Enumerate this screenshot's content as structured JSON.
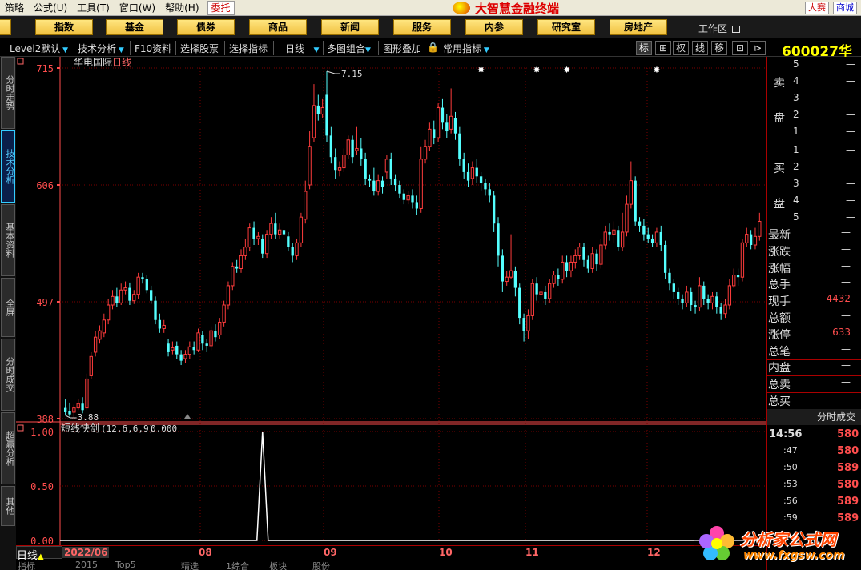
{
  "menubar": {
    "items": [
      "策略",
      "公式(U)",
      "工具(T)",
      "窗口(W)",
      "帮助(H)"
    ],
    "entrust": "委托",
    "brand": "大智慧金融终端",
    "right_buttons": [
      "大赛",
      "商城"
    ]
  },
  "navbar": {
    "buttons": [
      "指数",
      "基金",
      "债券",
      "商品",
      "新闻",
      "服务",
      "内参",
      "研究室",
      "房地产"
    ],
    "workzone": "工作区"
  },
  "toolbar": {
    "level2": "Level2默认",
    "tech": "技术分析",
    "f10": "F10资料",
    "select_stock": "选择股票",
    "select_indicator": "选择指标",
    "period": "日线",
    "multi": "多图组合",
    "overlay": "图形叠加",
    "common": "常用指标",
    "tiny_buttons": [
      "标",
      "⊞",
      "权",
      "线",
      "移",
      "⊡",
      "⊳"
    ],
    "stock_code": "600027",
    "stock_code_suffix": "华"
  },
  "side_tabs": [
    "分时走势",
    "技术分析",
    "基本资料",
    "全屏",
    "分时成交",
    "超赢分析",
    "其他"
  ],
  "chart_data": [
    {
      "type": "candlestick",
      "title": "华电国际日线",
      "title_stock": "华电国际",
      "title_period": "日线",
      "ylim": [
        388,
        715
      ],
      "y_ticks": [
        715,
        606,
        497,
        388
      ],
      "y_tick_labels": [
        "715",
        "606",
        "497",
        "388"
      ],
      "annotations": {
        "high": "7.15",
        "low": "3.88"
      },
      "date_labels": [
        "2022/06",
        "08",
        "09",
        "10",
        "11",
        "12"
      ],
      "candles": [
        [
          398,
          394,
          406,
          391
        ],
        [
          395,
          392,
          403,
          390
        ],
        [
          394,
          398,
          401,
          389
        ],
        [
          398,
          402,
          406,
          396
        ],
        [
          402,
          396,
          408,
          393
        ],
        [
          398,
          425,
          430,
          396
        ],
        [
          428,
          446,
          450,
          425
        ],
        [
          450,
          464,
          470,
          446
        ],
        [
          462,
          470,
          475,
          458
        ],
        [
          468,
          480,
          486,
          464
        ],
        [
          480,
          494,
          500,
          476
        ],
        [
          494,
          502,
          508,
          490
        ],
        [
          502,
          496,
          510,
          492
        ],
        [
          496,
          508,
          514,
          494
        ],
        [
          508,
          510,
          516,
          504
        ],
        [
          510,
          498,
          515,
          494
        ],
        [
          498,
          504,
          508,
          495
        ],
        [
          504,
          520,
          524,
          500
        ],
        [
          520,
          518,
          524,
          514
        ],
        [
          518,
          508,
          522,
          505
        ],
        [
          508,
          498,
          512,
          495
        ],
        [
          498,
          480,
          502,
          476
        ],
        [
          480,
          472,
          486,
          468
        ],
        [
          472,
          475,
          480,
          468
        ],
        [
          458,
          450,
          462,
          446
        ],
        [
          452,
          454,
          460,
          448
        ],
        [
          456,
          448,
          460,
          444
        ],
        [
          448,
          442,
          452,
          438
        ],
        [
          444,
          448,
          452,
          440
        ],
        [
          448,
          455,
          460,
          444
        ],
        [
          455,
          452,
          460,
          448
        ],
        [
          452,
          468,
          472,
          450
        ],
        [
          466,
          458,
          470,
          452
        ],
        [
          458,
          456,
          462,
          450
        ],
        [
          456,
          470,
          474,
          452
        ],
        [
          470,
          464,
          476,
          460
        ],
        [
          466,
          478,
          482,
          462
        ],
        [
          478,
          494,
          498,
          474
        ],
        [
          494,
          512,
          516,
          490
        ],
        [
          512,
          530,
          534,
          508
        ],
        [
          530,
          528,
          536,
          524
        ],
        [
          528,
          540,
          546,
          524
        ],
        [
          540,
          548,
          556,
          536
        ],
        [
          548,
          566,
          570,
          544
        ],
        [
          566,
          556,
          572,
          550
        ],
        [
          556,
          558,
          562,
          550
        ],
        [
          556,
          542,
          560,
          538
        ],
        [
          542,
          560,
          564,
          538
        ],
        [
          560,
          570,
          576,
          556
        ],
        [
          570,
          560,
          580,
          556
        ],
        [
          560,
          564,
          570,
          556
        ],
        [
          564,
          560,
          568,
          552
        ],
        [
          558,
          548,
          562,
          544
        ],
        [
          548,
          540,
          552,
          534
        ],
        [
          540,
          552,
          556,
          536
        ],
        [
          552,
          576,
          580,
          548
        ],
        [
          574,
          600,
          610,
          570
        ],
        [
          606,
          642,
          656,
          602
        ],
        [
          650,
          680,
          700,
          646
        ],
        [
          680,
          672,
          690,
          666
        ],
        [
          672,
          678,
          686,
          668
        ],
        [
          690,
          652,
          712,
          646
        ],
        [
          652,
          632,
          660,
          626
        ],
        [
          632,
          620,
          640,
          612
        ],
        [
          620,
          622,
          628,
          614
        ],
        [
          622,
          634,
          640,
          618
        ],
        [
          634,
          648,
          652,
          630
        ],
        [
          648,
          632,
          652,
          626
        ],
        [
          638,
          640,
          660,
          634
        ],
        [
          640,
          630,
          650,
          624
        ],
        [
          630,
          612,
          636,
          606
        ],
        [
          612,
          610,
          616,
          604
        ],
        [
          610,
          600,
          622,
          596
        ],
        [
          600,
          610,
          616,
          596
        ],
        [
          610,
          604,
          614,
          598
        ],
        [
          618,
          630,
          634,
          612
        ],
        [
          630,
          612,
          636,
          606
        ],
        [
          612,
          606,
          616,
          600
        ],
        [
          606,
          598,
          610,
          594
        ],
        [
          598,
          592,
          602,
          588
        ],
        [
          592,
          596,
          600,
          588
        ],
        [
          596,
          590,
          602,
          584
        ],
        [
          590,
          584,
          596,
          578
        ],
        [
          584,
          630,
          642,
          580
        ],
        [
          630,
          642,
          648,
          626
        ],
        [
          642,
          658,
          664,
          638
        ],
        [
          658,
          650,
          666,
          644
        ],
        [
          650,
          678,
          682,
          646
        ],
        [
          678,
          664,
          686,
          658
        ],
        [
          664,
          656,
          672,
          650
        ],
        [
          658,
          670,
          696,
          654
        ],
        [
          668,
          654,
          674,
          648
        ],
        [
          654,
          630,
          660,
          624
        ],
        [
          630,
          618,
          636,
          612
        ],
        [
          618,
          610,
          626,
          604
        ],
        [
          612,
          622,
          628,
          606
        ],
        [
          622,
          614,
          630,
          608
        ],
        [
          614,
          608,
          618,
          600
        ],
        [
          608,
          602,
          612,
          596
        ],
        [
          602,
          596,
          608,
          590
        ],
        [
          596,
          570,
          600,
          562
        ],
        [
          570,
          540,
          576,
          530
        ],
        [
          540,
          516,
          546,
          506
        ],
        [
          516,
          520,
          526,
          512
        ],
        [
          520,
          526,
          560,
          518
        ],
        [
          526,
          510,
          530,
          502
        ],
        [
          510,
          482,
          514,
          476
        ],
        [
          482,
          470,
          486,
          460
        ],
        [
          470,
          484,
          490,
          462
        ],
        [
          484,
          514,
          518,
          480
        ],
        [
          514,
          504,
          520,
          498
        ],
        [
          504,
          506,
          512,
          500
        ],
        [
          506,
          500,
          512,
          494
        ],
        [
          500,
          514,
          518,
          496
        ],
        [
          514,
          522,
          526,
          510
        ],
        [
          522,
          518,
          528,
          512
        ],
        [
          518,
          534,
          540,
          514
        ],
        [
          534,
          526,
          540,
          520
        ],
        [
          526,
          534,
          540,
          520
        ],
        [
          534,
          540,
          546,
          528
        ],
        [
          540,
          548,
          552,
          536
        ],
        [
          548,
          536,
          552,
          530
        ],
        [
          536,
          528,
          540,
          524
        ],
        [
          528,
          542,
          548,
          524
        ],
        [
          542,
          532,
          546,
          526
        ],
        [
          532,
          550,
          556,
          528
        ],
        [
          550,
          562,
          568,
          546
        ],
        [
          562,
          560,
          570,
          554
        ],
        [
          560,
          564,
          572,
          552
        ],
        [
          564,
          548,
          568,
          544
        ],
        [
          548,
          562,
          580,
          544
        ],
        [
          562,
          588,
          596,
          558
        ],
        [
          588,
          610,
          628,
          584
        ],
        [
          610,
          572,
          614,
          568
        ],
        [
          572,
          568,
          576,
          562
        ],
        [
          568,
          560,
          574,
          554
        ],
        [
          560,
          556,
          566,
          552
        ],
        [
          556,
          552,
          560,
          548
        ],
        [
          552,
          562,
          566,
          548
        ],
        [
          562,
          550,
          568,
          544
        ],
        [
          550,
          524,
          554,
          518
        ],
        [
          524,
          514,
          528,
          508
        ],
        [
          514,
          506,
          518,
          500
        ],
        [
          506,
          500,
          510,
          494
        ],
        [
          500,
          496,
          504,
          490
        ],
        [
          496,
          506,
          512,
          492
        ],
        [
          506,
          494,
          510,
          488
        ],
        [
          494,
          492,
          498,
          486
        ],
        [
          492,
          512,
          520,
          488
        ],
        [
          512,
          500,
          516,
          494
        ],
        [
          500,
          496,
          504,
          490
        ],
        [
          496,
          502,
          506,
          490
        ],
        [
          502,
          492,
          506,
          486
        ],
        [
          492,
          486,
          496,
          480
        ],
        [
          486,
          494,
          500,
          482
        ],
        [
          494,
          512,
          518,
          490
        ],
        [
          512,
          522,
          528,
          510
        ],
        [
          522,
          520,
          528,
          512
        ],
        [
          520,
          552,
          556,
          516
        ],
        [
          552,
          560,
          566,
          548
        ],
        [
          560,
          550,
          564,
          546
        ],
        [
          550,
          558,
          566,
          546
        ],
        [
          558,
          572,
          580,
          554
        ]
      ],
      "markers": [
        {
          "index": 61,
          "label": "7.15",
          "kind": "high"
        },
        {
          "index": 0,
          "label": "3.88",
          "kind": "low"
        }
      ]
    },
    {
      "type": "line",
      "title": "短线快剑(12,6,6,9) 0.000",
      "name": "短线快剑",
      "params": "(12,6,6,9)",
      "current_value": "0.000",
      "ylim": [
        0,
        1
      ],
      "y_ticks": [
        1.0,
        0.5,
        0.0
      ],
      "y_tick_labels": [
        "1.00",
        "0.50",
        "0.00"
      ],
      "spike_index": 46,
      "spike_value": 1.0
    }
  ],
  "right_panel": {
    "sell_label": [
      "卖",
      "盘"
    ],
    "buy_label": [
      "买",
      "盘"
    ],
    "sell_rows": [
      [
        "5",
        "—"
      ],
      [
        "4",
        "—"
      ],
      [
        "3",
        "—"
      ],
      [
        "2",
        "—"
      ],
      [
        "1",
        "—"
      ]
    ],
    "buy_rows": [
      [
        "1",
        "—"
      ],
      [
        "2",
        "—"
      ],
      [
        "3",
        "—"
      ],
      [
        "4",
        "—"
      ],
      [
        "5",
        "—"
      ]
    ],
    "quotes": [
      {
        "k": "最新",
        "v": "—",
        "red": false
      },
      {
        "k": "涨跌",
        "v": "—",
        "red": false
      },
      {
        "k": "涨幅",
        "v": "—",
        "red": false
      },
      {
        "k": "总手",
        "v": "—",
        "red": false
      },
      {
        "k": "现手",
        "v": "4432",
        "red": true
      },
      {
        "k": "总额",
        "v": "—",
        "red": false
      },
      {
        "k": "涨停",
        "v": "633",
        "red": true
      },
      {
        "k": "总笔",
        "v": "—",
        "red": false
      },
      {
        "k": "内盘",
        "v": "—",
        "red": false
      },
      {
        "k": "总卖",
        "v": "—",
        "red": false
      },
      {
        "k": "总买",
        "v": "—",
        "red": false
      }
    ],
    "minute_header": "分时成交",
    "minute_rows": [
      {
        "t": "14:56",
        "p": "580",
        "big": true
      },
      {
        "t": ":47",
        "p": "580",
        "big": false
      },
      {
        "t": ":50",
        "p": "589",
        "big": false
      },
      {
        "t": ":53",
        "p": "580",
        "big": false
      },
      {
        "t": ":56",
        "p": "589",
        "big": false
      },
      {
        "t": ":59",
        "p": "589",
        "big": false
      }
    ]
  },
  "bottom": {
    "period": "日线",
    "date_labels": [
      "2022/06",
      "08",
      "09",
      "10",
      "11",
      "12"
    ],
    "tabs": [
      "指标",
      "2015",
      "Top5",
      "精选",
      "1综合",
      "板块",
      "股份"
    ]
  },
  "watermark": {
    "text1": "分析家公式网",
    "text2": "www.fxgsw.com"
  },
  "colors": {
    "up": "#ff3c3c",
    "down": "#54ffff",
    "grid": "#7a0000",
    "axis": "#ff4d4d",
    "spike": "#ffffff"
  }
}
